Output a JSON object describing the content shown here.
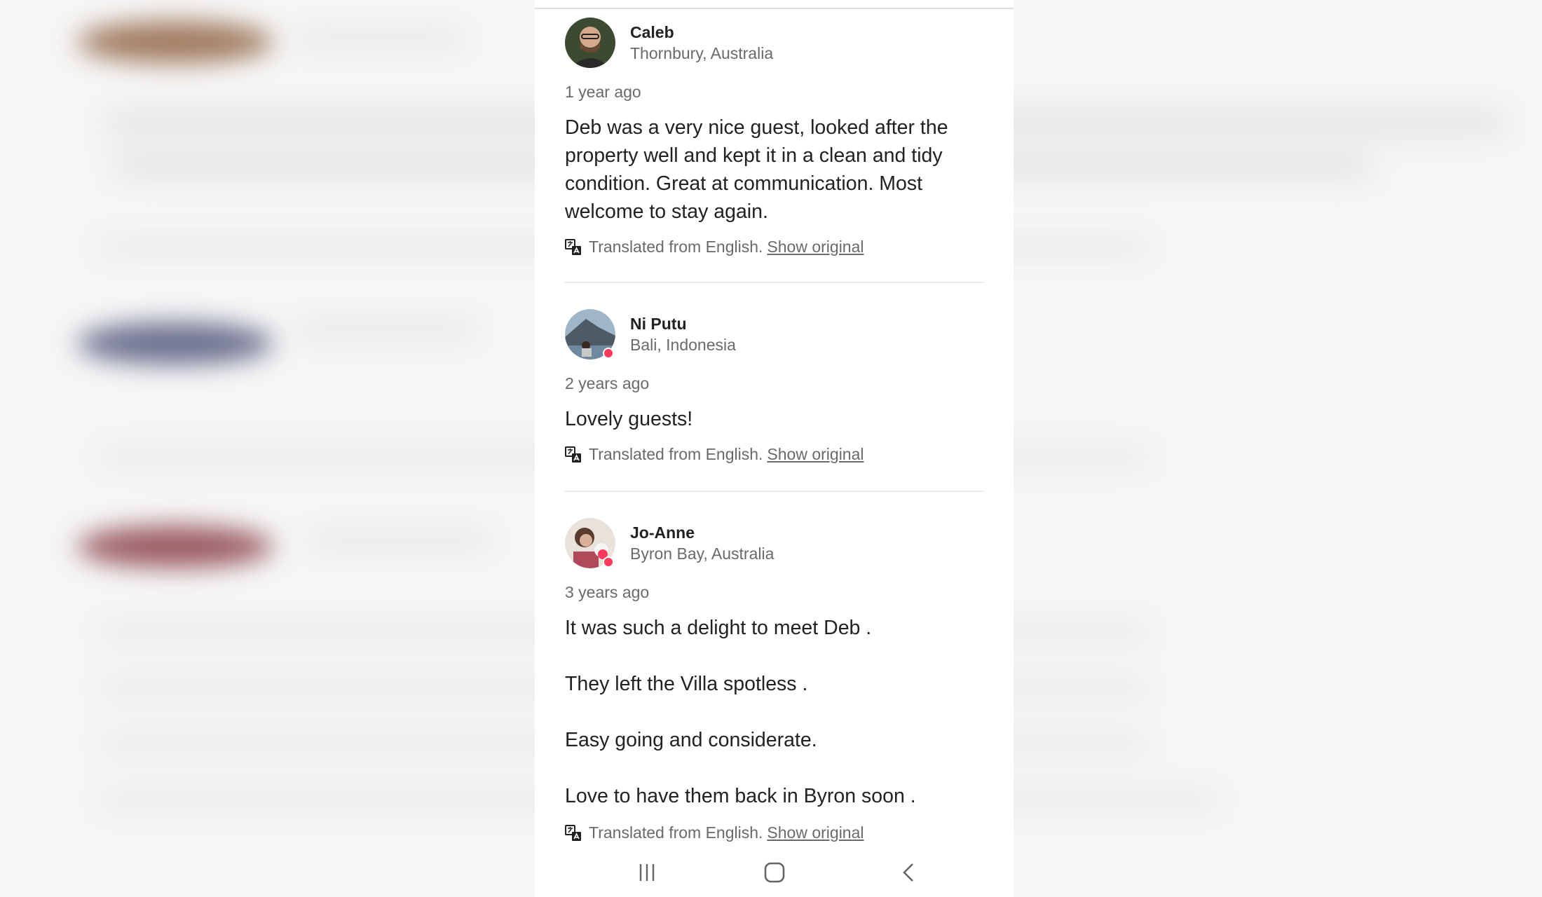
{
  "reviews": [
    {
      "name": "Caleb",
      "location": "Thornbury, Australia",
      "time": "1 year ago",
      "text": [
        "Deb was a very nice guest, looked after the property well and kept it in a clean and tidy condition. Great at communication. Most welcome to stay again."
      ],
      "translated_label": "Translated from English.",
      "show_original": "Show original"
    },
    {
      "name": "Ni Putu",
      "location": "Bali, Indonesia",
      "time": "2 years ago",
      "text": [
        "Lovely guests!"
      ],
      "translated_label": "Translated from English.",
      "show_original": "Show original"
    },
    {
      "name": "Jo-Anne",
      "location": "Byron Bay, Australia",
      "time": "3 years ago",
      "text": [
        "It was such a delight to meet Deb .",
        "They left the Villa spotless .",
        "Easy going and considerate.",
        "Love to have them back in Byron soon ."
      ],
      "translated_label": "Translated from English.",
      "show_original": "Show original"
    }
  ],
  "nav": {
    "recent_icon": "recent-apps-icon",
    "home_icon": "home-icon",
    "back_icon": "back-icon"
  },
  "colors": {
    "text": "#222222",
    "muted": "#6a6a6a",
    "badge": "#ff385c"
  }
}
